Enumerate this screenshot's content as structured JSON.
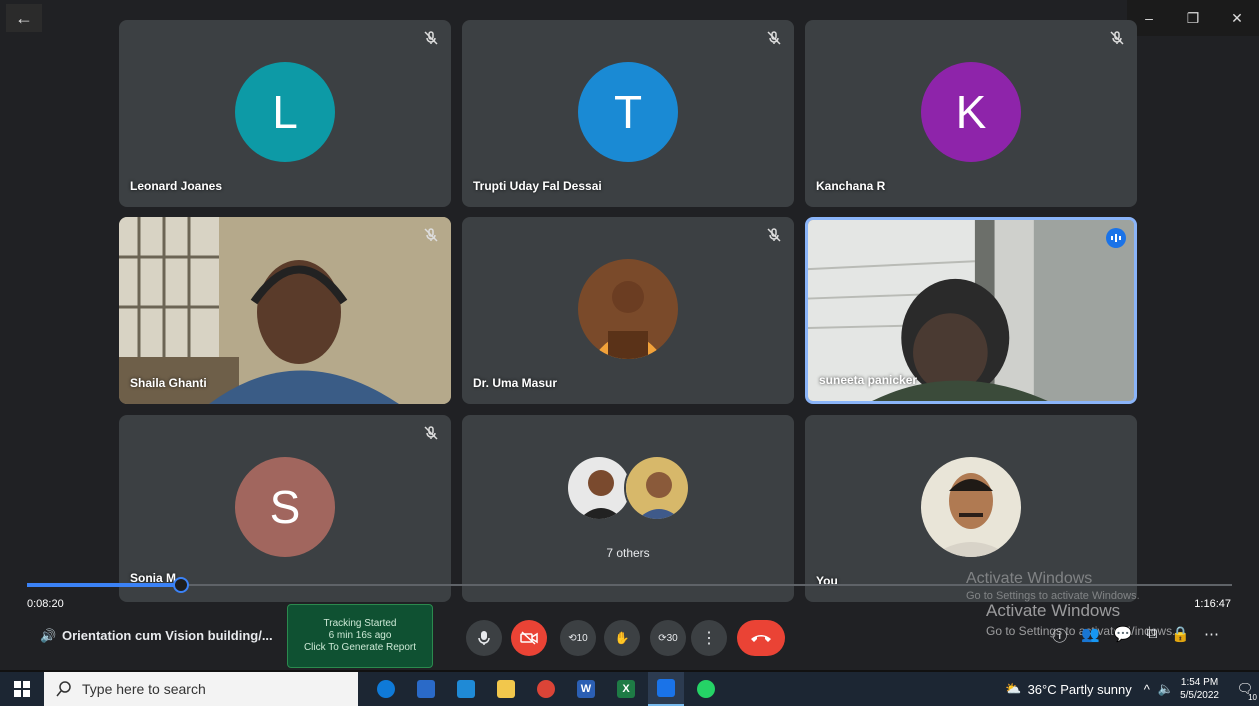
{
  "window": {
    "back_glyph": "←",
    "controls": [
      "–",
      "❐",
      "✕"
    ]
  },
  "participants": [
    {
      "name": "Leonard Joanes",
      "initial": "L",
      "avatar_color": "#0d9aa6",
      "muted": true
    },
    {
      "name": "Trupti Uday Fal Dessai",
      "initial": "T",
      "avatar_color": "#1a8ad4",
      "muted": true
    },
    {
      "name": "Kanchana R",
      "initial": "K",
      "avatar_color": "#8e24aa",
      "muted": true
    },
    {
      "name": "Shaila Ghanti",
      "muted": true,
      "video": true
    },
    {
      "name": "Dr. Uma Masur",
      "muted": true,
      "photo": true
    },
    {
      "name": "suneeta panicker",
      "speaking": true,
      "video": true
    },
    {
      "name": "Sonia M",
      "initial": "S",
      "avatar_color": "#a1665e",
      "muted": true
    },
    {
      "name": "7 others"
    },
    {
      "name": "You",
      "photo": true
    }
  ],
  "player": {
    "current_time": "0:08:20",
    "total_time": "1:16:47",
    "progress_fraction": 0.128
  },
  "meeting": {
    "title": "Orientation cum Vision building/...",
    "tracking": {
      "line1": "Tracking Started",
      "line2": "6 min 16s ago",
      "line3": "Click To Generate Report"
    },
    "controls": {
      "rewind_label": "10",
      "forward_label": "30"
    }
  },
  "watermark": {
    "title": "Activate Windows",
    "subtitle": "Go to Settings to activate Windows.",
    "title2": "Activate Windows",
    "subtitle2": "Go to Settings to activate Windows."
  },
  "taskbar": {
    "search_placeholder": "Type here to search",
    "weather": "36°C  Partly sunny",
    "time": "1:54 PM",
    "date": "5/5/2022",
    "notification_count": "10"
  },
  "colors": {
    "accent": "#1a73e8",
    "end_call": "#ea4335",
    "tile_bg": "#3c4043"
  }
}
